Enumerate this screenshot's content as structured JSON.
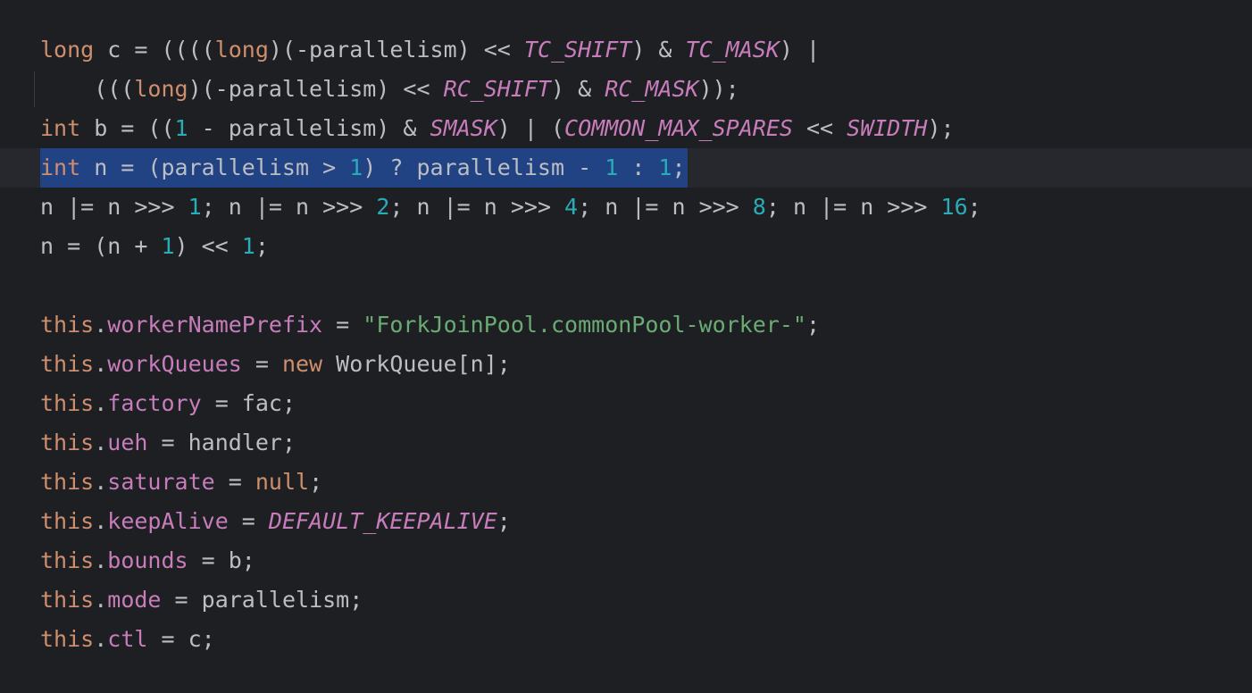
{
  "editor": {
    "selected_line": 3,
    "current_line": 3,
    "lines": [
      [
        [
          "kw",
          "long"
        ],
        [
          "id",
          " c = (((("
        ],
        [
          "kw",
          "long"
        ],
        [
          "id",
          ")(-parallelism) << "
        ],
        [
          "const",
          "TC_SHIFT"
        ],
        [
          "id",
          ") & "
        ],
        [
          "const",
          "TC_MASK"
        ],
        [
          "id",
          ") |"
        ]
      ],
      [
        [
          "id",
          "    ((("
        ],
        [
          "kw",
          "long"
        ],
        [
          "id",
          ")(-parallelism) << "
        ],
        [
          "const",
          "RC_SHIFT"
        ],
        [
          "id",
          ") & "
        ],
        [
          "const",
          "RC_MASK"
        ],
        [
          "id",
          "));"
        ]
      ],
      [
        [
          "kw",
          "int"
        ],
        [
          "id",
          " b = (("
        ],
        [
          "num",
          "1"
        ],
        [
          "id",
          " - parallelism) & "
        ],
        [
          "const",
          "SMASK"
        ],
        [
          "id",
          ") | ("
        ],
        [
          "const",
          "COMMON_MAX_SPARES"
        ],
        [
          "id",
          " << "
        ],
        [
          "const",
          "SWIDTH"
        ],
        [
          "id",
          ");"
        ]
      ],
      [
        [
          "kw",
          "int"
        ],
        [
          "id",
          " n = (parallelism > "
        ],
        [
          "num",
          "1"
        ],
        [
          "id",
          ") ? parallelism - "
        ],
        [
          "num",
          "1"
        ],
        [
          "id",
          " : "
        ],
        [
          "num",
          "1"
        ],
        [
          "id",
          ";"
        ]
      ],
      [
        [
          "id",
          "n |= n >>> "
        ],
        [
          "num",
          "1"
        ],
        [
          "id",
          "; n |= n >>> "
        ],
        [
          "num",
          "2"
        ],
        [
          "id",
          "; n |= n >>> "
        ],
        [
          "num",
          "4"
        ],
        [
          "id",
          "; n |= n >>> "
        ],
        [
          "num",
          "8"
        ],
        [
          "id",
          "; n |= n >>> "
        ],
        [
          "num",
          "16"
        ],
        [
          "id",
          ";"
        ]
      ],
      [
        [
          "id",
          "n = (n + "
        ],
        [
          "num",
          "1"
        ],
        [
          "id",
          ") << "
        ],
        [
          "num",
          "1"
        ],
        [
          "id",
          ";"
        ]
      ],
      [],
      [
        [
          "kw",
          "this"
        ],
        [
          "id",
          "."
        ],
        [
          "field",
          "workerNamePrefix"
        ],
        [
          "id",
          " = "
        ],
        [
          "str",
          "\"ForkJoinPool.commonPool-worker-\""
        ],
        [
          "id",
          ";"
        ]
      ],
      [
        [
          "kw",
          "this"
        ],
        [
          "id",
          "."
        ],
        [
          "field",
          "workQueues"
        ],
        [
          "id",
          " = "
        ],
        [
          "kw",
          "new"
        ],
        [
          "id",
          " WorkQueue[n];"
        ]
      ],
      [
        [
          "kw",
          "this"
        ],
        [
          "id",
          "."
        ],
        [
          "field",
          "factory"
        ],
        [
          "id",
          " = fac;"
        ]
      ],
      [
        [
          "kw",
          "this"
        ],
        [
          "id",
          "."
        ],
        [
          "field",
          "ueh"
        ],
        [
          "id",
          " = handler;"
        ]
      ],
      [
        [
          "kw",
          "this"
        ],
        [
          "id",
          "."
        ],
        [
          "field",
          "saturate"
        ],
        [
          "id",
          " = "
        ],
        [
          "kw",
          "null"
        ],
        [
          "id",
          ";"
        ]
      ],
      [
        [
          "kw",
          "this"
        ],
        [
          "id",
          "."
        ],
        [
          "field",
          "keepAlive"
        ],
        [
          "id",
          " = "
        ],
        [
          "const",
          "DEFAULT_KEEPALIVE"
        ],
        [
          "id",
          ";"
        ]
      ],
      [
        [
          "kw",
          "this"
        ],
        [
          "id",
          "."
        ],
        [
          "field",
          "bounds"
        ],
        [
          "id",
          " = b;"
        ]
      ],
      [
        [
          "kw",
          "this"
        ],
        [
          "id",
          "."
        ],
        [
          "field",
          "mode"
        ],
        [
          "id",
          " = parallelism;"
        ]
      ],
      [
        [
          "kw",
          "this"
        ],
        [
          "id",
          "."
        ],
        [
          "field",
          "ctl"
        ],
        [
          "id",
          " = c;"
        ]
      ]
    ]
  },
  "colors": {
    "background": "#1e1f22",
    "selection": "#214283",
    "keyword": "#cf8e6d",
    "number": "#2aacb8",
    "constant": "#c77dbb",
    "string": "#6aab73",
    "text": "#bcbec4"
  }
}
